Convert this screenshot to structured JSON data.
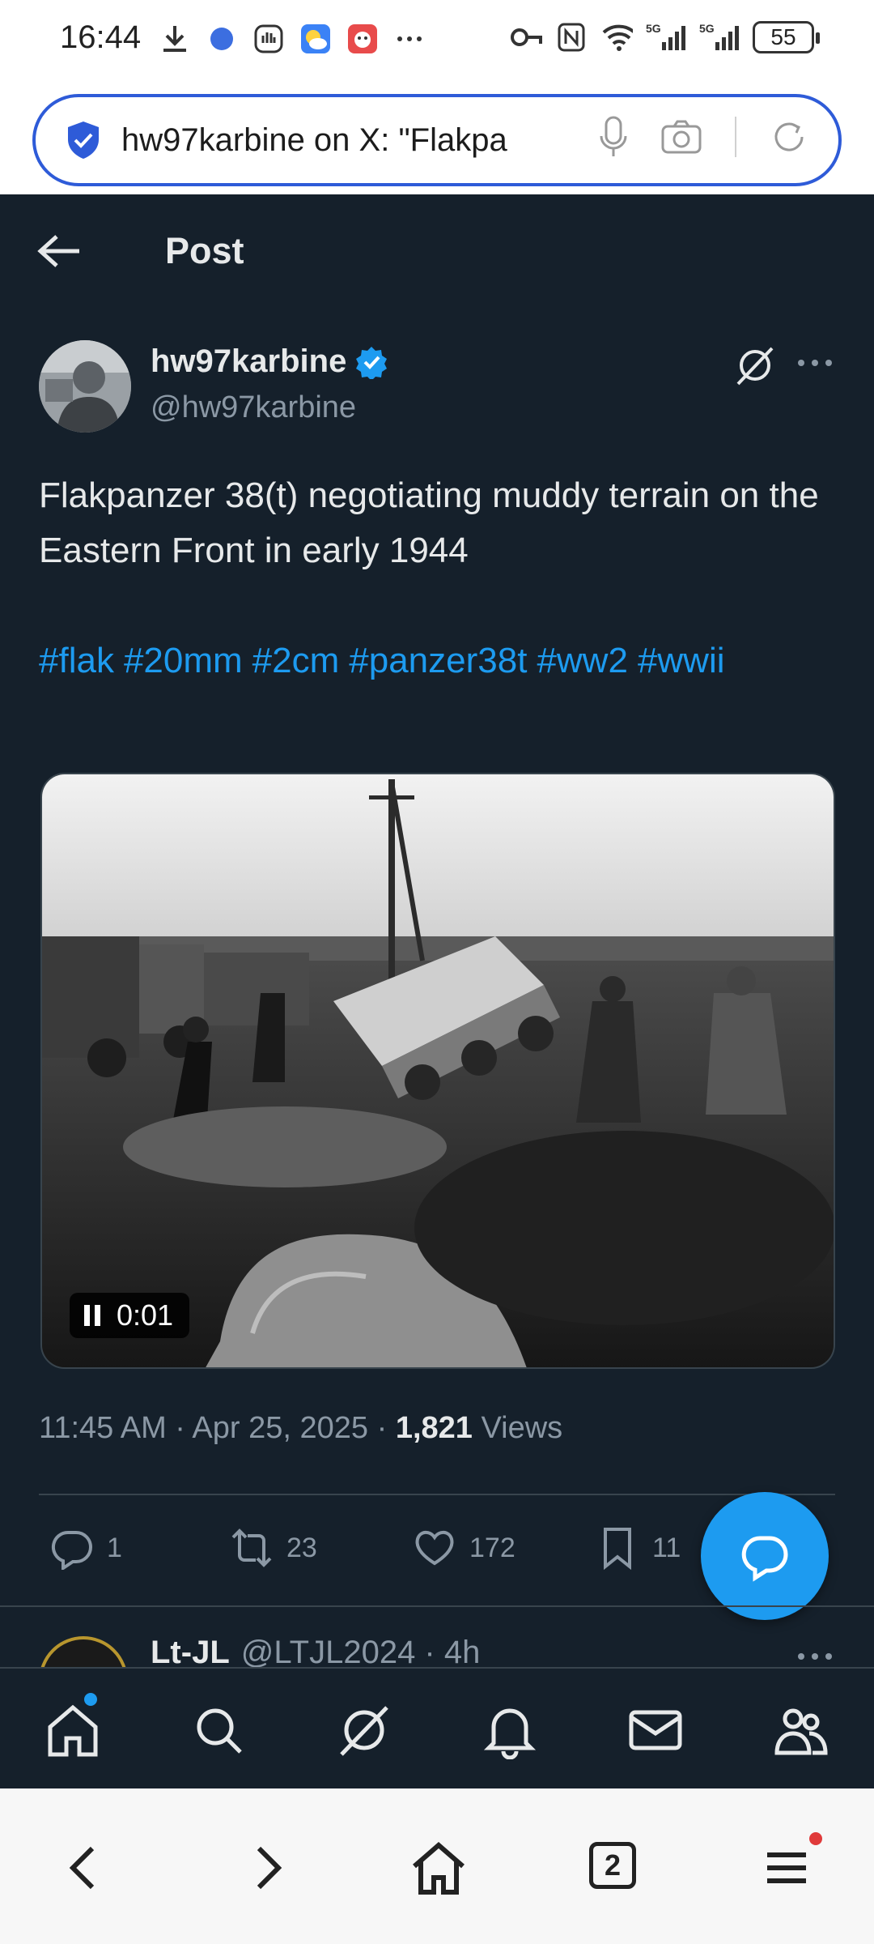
{
  "status_bar": {
    "time": "16:44",
    "battery": "55",
    "network_label_1": "5G",
    "network_label_2": "5G"
  },
  "browser": {
    "url_text": "hw97karbine on X: \"Flakpa",
    "tabs_count": "2"
  },
  "header": {
    "title": "Post"
  },
  "post": {
    "author_name": "hw97karbine",
    "author_handle": "@hw97karbine",
    "text_line": "Flakpanzer 38(t) negotiating muddy terrain on the Eastern Front in early 1944",
    "hashtags": [
      "#flak",
      "#20mm",
      "#2cm",
      "#panzer38t",
      "#ww2",
      "#wwii"
    ],
    "video_time": "0:01",
    "time": "11:45 AM",
    "date": "Apr 25, 2025",
    "views_count": "1,821",
    "views_label": "Views",
    "separator": "·"
  },
  "actions": {
    "replies": "1",
    "reposts": "23",
    "likes": "172",
    "bookmarks": "11"
  },
  "reply_preview": {
    "name": "Lt-JL",
    "handle_time": "@LTJL2024 · 4h"
  },
  "colors": {
    "background": "#15202b",
    "accent": "#1d9bf0",
    "text_primary": "#e7e9ea",
    "text_secondary": "#8b98a5",
    "url_border": "#2e5bd8"
  }
}
